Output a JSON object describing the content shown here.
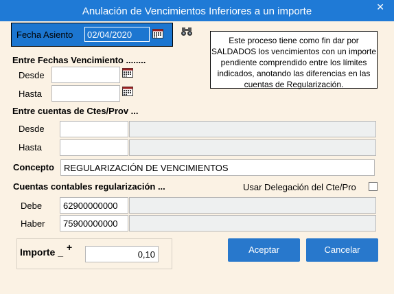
{
  "window": {
    "title": "Anulación de Vencimientos Inferiores a un importe",
    "close_label": "✕"
  },
  "fecha_asiento": {
    "label": "Fecha Asiento",
    "value": "02/04/2020"
  },
  "info_text": "Este proceso tiene como fin dar por SALDADOS los vencimientos con un importe pendiente comprendido entre los límites indicados, anotando las diferencias en las cuentas de Regularización.",
  "fechas": {
    "section_label": "Entre Fechas Vencimiento ........",
    "desde_label": "Desde",
    "desde_value": "",
    "hasta_label": "Hasta",
    "hasta_value": ""
  },
  "cuentas": {
    "section_label": "Entre cuentas de Ctes/Prov ...",
    "desde_label": "Desde",
    "desde_code": "",
    "desde_name": "",
    "hasta_label": "Hasta",
    "hasta_code": "",
    "hasta_name": ""
  },
  "concepto": {
    "label": "Concepto",
    "value": "REGULARIZACIÓN DE VENCIMIENTOS"
  },
  "regularizacion": {
    "section_label": "Cuentas contables regularización ...",
    "delegacion_label": "Usar Delegación del Cte/Pro",
    "delegacion_checked": false,
    "debe_label": "Debe",
    "debe_code": "62900000000",
    "debe_name": "",
    "haber_label": "Haber",
    "haber_code": "75900000000",
    "haber_name": ""
  },
  "importe": {
    "label": "Importe _",
    "plusminus": "+",
    "value": "0,10"
  },
  "buttons": {
    "aceptar": "Aceptar",
    "cancelar": "Cancelar"
  },
  "colors": {
    "titlebar": "#1f7ad6",
    "background": "#fbf2e4",
    "button": "#2878cc",
    "fecha_box": "#1c76d0"
  },
  "icons": {
    "calendar": "calendar-icon",
    "binoculars": "binoculars-icon",
    "close": "close-icon"
  }
}
